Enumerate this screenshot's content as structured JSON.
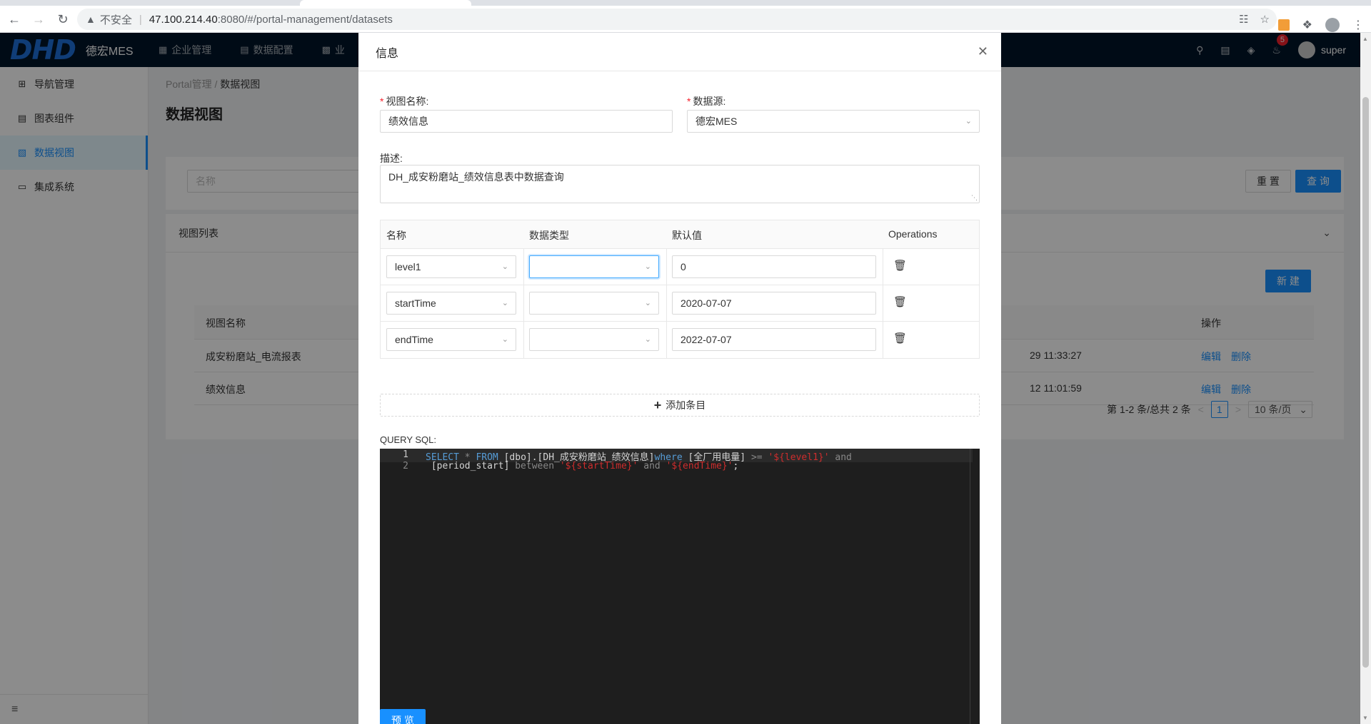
{
  "browser": {
    "insecure_label": "不安全",
    "url_host": "47.100.214.40",
    "url_path": ":8080/#/portal-management/datasets"
  },
  "header": {
    "logo_mark": "DHD",
    "app_name": "德宏MES",
    "menu": [
      {
        "label": "企业管理",
        "icon": "building-icon"
      },
      {
        "label": "数据配置",
        "icon": "file-icon"
      },
      {
        "label": "业",
        "icon": "grid-icon"
      }
    ],
    "notification_count": "5",
    "user_name": "super"
  },
  "sidebar": {
    "items": [
      {
        "label": "导航管理",
        "icon": "apps-icon",
        "active": false
      },
      {
        "label": "图表组件",
        "icon": "chart-icon",
        "active": false
      },
      {
        "label": "数据视图",
        "icon": "dataset-icon",
        "active": true
      },
      {
        "label": "集成系统",
        "icon": "monitor-icon",
        "active": false
      }
    ]
  },
  "main": {
    "breadcrumb": [
      "Portal管理",
      "数据视图"
    ],
    "page_title": "数据视图",
    "search": {
      "placeholder": "名称",
      "reset_label": "重 置",
      "query_label": "查 询"
    },
    "list": {
      "title": "视图列表",
      "new_label": "新 建",
      "columns": {
        "name": "视图名称",
        "ops": "操作"
      },
      "rows": [
        {
          "name": "成安粉磨站_电流报表",
          "time": "29 11:33:27",
          "edit": "编辑",
          "delete": "删除"
        },
        {
          "name": "绩效信息",
          "time": "12 11:01:59",
          "edit": "编辑",
          "delete": "删除"
        }
      ],
      "pagination": {
        "summary": "第 1-2 条/总共 2 条",
        "current_page": "1",
        "page_size": "10 条/页"
      }
    }
  },
  "modal": {
    "title": "信息",
    "view_name_label": "视图名称:",
    "view_name_value": "绩效信息",
    "datasource_label": "数据源:",
    "datasource_value": "德宏MES",
    "desc_label": "描述:",
    "desc_value": "DH_成安粉磨站_绩效信息表中数据查询",
    "param_columns": {
      "name": "名称",
      "type": "数据类型",
      "default": "默认值",
      "ops": "Operations"
    },
    "params": [
      {
        "name": "level1",
        "type": "",
        "default": "0"
      },
      {
        "name": "startTime",
        "type": "",
        "default": "2020-07-07"
      },
      {
        "name": "endTime",
        "type": "",
        "default": "2022-07-07"
      }
    ],
    "add_item_label": "添加条目",
    "sql_label": "QUERY SQL:",
    "sql_lines": {
      "line1_no": "1",
      "line2_no": "2",
      "l1_select": "SELECT",
      "l1_star": " * ",
      "l1_from": "FROM",
      "l1_table": " [dbo].[DH_成安粉磨站_绩效信息]",
      "l1_where": "where",
      "l1_col": " [全厂用电量] ",
      "l1_op": ">=",
      "l1_val": " '${level1}'",
      "l1_and": " and",
      "l2_col": " [period_start] ",
      "l2_between": "between",
      "l2_v1": " '${startTime}'",
      "l2_and": " and ",
      "l2_v2": "'${endTime}'",
      "l2_end": ";"
    },
    "preview_label": "预 览"
  }
}
